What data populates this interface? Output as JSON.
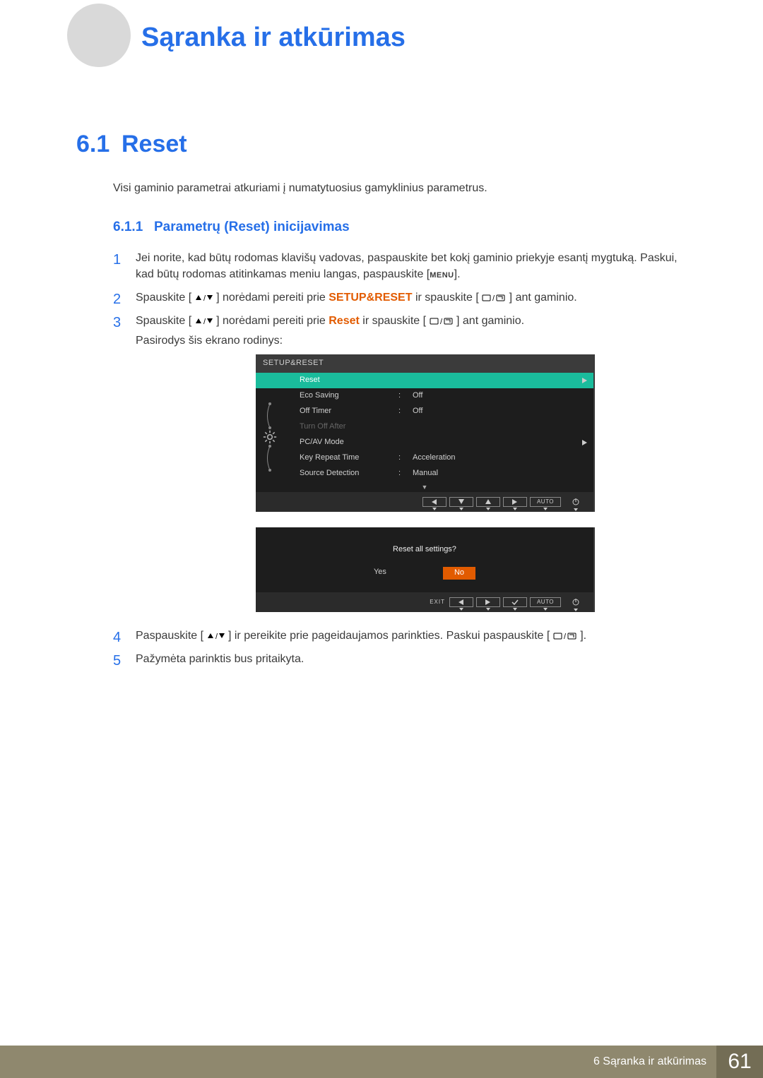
{
  "chapter_title": "Sąranka ir atkūrimas",
  "section": {
    "num": "6.1",
    "title": "Reset"
  },
  "intro": "Visi gaminio parametrai atkuriami į numatytuosius gamyklinius parametrus.",
  "subsection": {
    "num": "6.1.1",
    "title": "Parametrų (Reset) inicijavimas"
  },
  "steps": {
    "s1": {
      "num": "1",
      "a": "Jei norite, kad būtų rodomas klavišų vadovas, paspauskite bet kokį gaminio priekyje esantį mygtuką. Paskui, kad būtų rodomas atitinkamas meniu langas, paspauskite [",
      "menu": "MENU",
      "b": "]."
    },
    "s2": {
      "num": "2",
      "a": "Spauskite [",
      "b": "] norėdami pereiti prie ",
      "setup": "SETUP&RESET",
      "c": " ir spauskite [",
      "d": "] ant gaminio."
    },
    "s3": {
      "num": "3",
      "a": "Spauskite [",
      "b": "] norėdami pereiti prie ",
      "reset": "Reset",
      "c": " ir spauskite [",
      "d": "] ant gaminio.",
      "after": "Pasirodys šis ekrano rodinys:"
    },
    "s4": {
      "num": "4",
      "a": "Paspauskite [",
      "b": "] ir pereikite prie pageidaujamos parinkties. Paskui paspauskite [",
      "c": "]."
    },
    "s5": {
      "num": "5",
      "a": "Pažymėta parinktis bus pritaikyta."
    }
  },
  "osd1": {
    "title": "SETUP&RESET",
    "rows": [
      {
        "label": "Reset",
        "val": ""
      },
      {
        "label": "Eco Saving",
        "val": "Off"
      },
      {
        "label": "Off Timer",
        "val": "Off"
      },
      {
        "label": "Turn Off After",
        "val": ""
      },
      {
        "label": "PC/AV Mode",
        "val": ""
      },
      {
        "label": "Key Repeat Time",
        "val": "Acceleration"
      },
      {
        "label": "Source Detection",
        "val": "Manual"
      }
    ],
    "auto": "AUTO"
  },
  "osd2": {
    "question": "Reset all settings?",
    "yes": "Yes",
    "no": "No",
    "exit": "EXIT",
    "auto": "AUTO"
  },
  "footer": {
    "text": "6 Sąranka ir atkūrimas",
    "page": "61"
  }
}
